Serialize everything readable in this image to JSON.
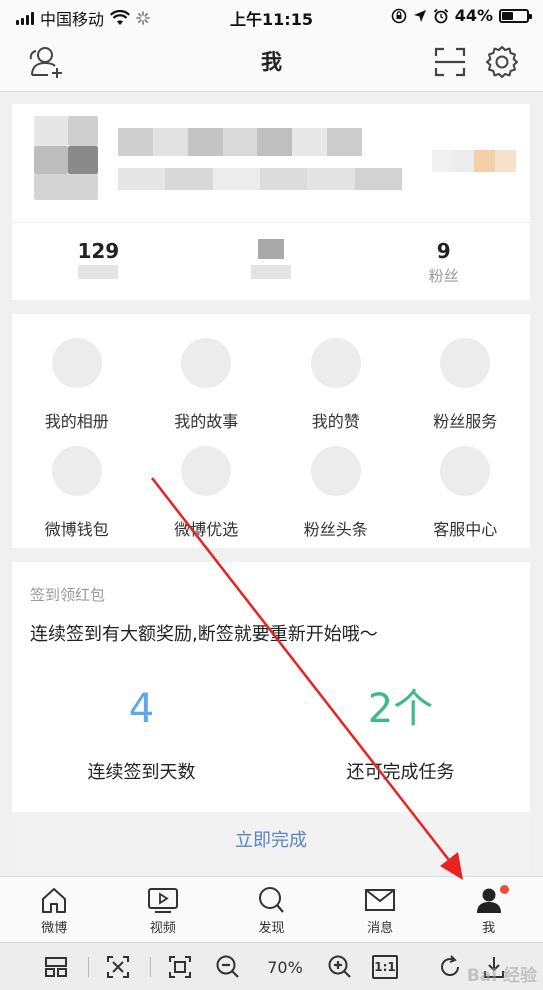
{
  "status_bar": {
    "carrier": "中国移动",
    "time": "上午11:15",
    "battery": "44%",
    "battery_level": 0.44
  },
  "nav": {
    "title": "我"
  },
  "profile": {
    "stats": [
      {
        "value": "129",
        "label": ""
      },
      {
        "value": "",
        "label": ""
      },
      {
        "value": "9",
        "label": "粉丝"
      }
    ]
  },
  "grid": {
    "items": [
      {
        "label": "我的相册"
      },
      {
        "label": "我的故事"
      },
      {
        "label": "我的赞"
      },
      {
        "label": "粉丝服务"
      },
      {
        "label": "微博钱包"
      },
      {
        "label": "微博优选"
      },
      {
        "label": "粉丝头条"
      },
      {
        "label": "客服中心"
      }
    ]
  },
  "checkin": {
    "title": "签到领红包",
    "description": "连续签到有大额奖励,断签就要重新开始哦～",
    "days_value": "4",
    "days_label": "连续签到天数",
    "tasks_value": "2个",
    "tasks_label": "还可完成任务",
    "complete_button": "立即完成",
    "colors": {
      "days": "#5ea7f0",
      "tasks": "#3fba82",
      "button": "#5a85c4"
    }
  },
  "tab_bar": {
    "tabs": [
      {
        "label": "微博",
        "icon": "home-icon"
      },
      {
        "label": "视频",
        "icon": "video-icon"
      },
      {
        "label": "发现",
        "icon": "search-icon"
      },
      {
        "label": "消息",
        "icon": "mail-icon"
      },
      {
        "label": "我",
        "icon": "profile-icon",
        "active": true,
        "badge": true
      }
    ]
  },
  "viewer_toolbar": {
    "zoom": "70%",
    "actual_size": "1:1"
  },
  "watermark": "Bai 经验",
  "accent_colors": {
    "annotation_arrow": "#e8231f",
    "badge": "#f04a3a"
  }
}
